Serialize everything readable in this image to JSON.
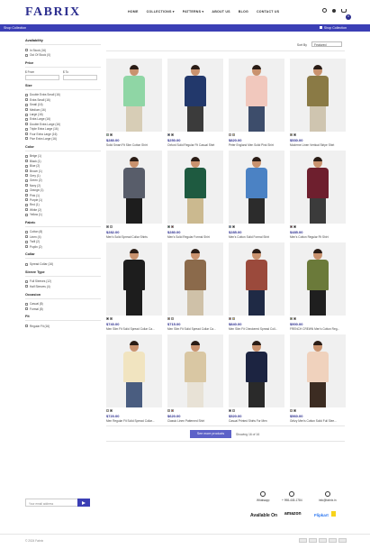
{
  "header": {
    "logo": "FABRIX",
    "nav": [
      "HOME",
      "COLLECTIONS ▾",
      "PATTERNS ▾",
      "ABOUT US",
      "BLOG",
      "CONTACT US"
    ],
    "cart_count": "0"
  },
  "banner": {
    "title": "Shop Collection",
    "breadcrumb": "Shop Collection"
  },
  "filters": {
    "availability": {
      "title": "Availability",
      "options": [
        "In Stock (16)",
        "Out Of Stock (0)"
      ]
    },
    "price": {
      "title": "Price",
      "from": "$ From",
      "to": "$ To"
    },
    "size": {
      "title": "Size",
      "options": [
        "Double Extra Small (16)",
        "Extra Small (16)",
        "Small (16)",
        "Medium (16)",
        "Large (16)",
        "Extra Large (16)",
        "Double Extra Large (16)",
        "Triple Extra Large (16)",
        "Four Extra Large (16)",
        "Five Extra Large (16)"
      ]
    },
    "color": {
      "title": "Color",
      "options": [
        "Beige (1)",
        "Black (1)",
        "Blue (2)",
        "Brown (1)",
        "Grey (1)",
        "Green (2)",
        "Navy (2)",
        "Orange (1)",
        "Pink (1)",
        "Purple (1)",
        "Red (1)",
        "White (2)",
        "Yellow (1)"
      ]
    },
    "fabric": {
      "title": "Fabric",
      "options": [
        "Cotton (8)",
        "Linen (4)",
        "Twill (2)",
        "Poplin (2)"
      ]
    },
    "collar": {
      "title": "Collar",
      "options": [
        "Spread Collar (16)"
      ]
    },
    "sleeve": {
      "title": "Sleeve Type",
      "options": [
        "Full Sleeves (12)",
        "Half Sleeves (4)"
      ]
    },
    "occasion": {
      "title": "Occasion",
      "options": [
        "Casual (8)",
        "Formal (8)"
      ]
    },
    "fit": {
      "title": "Fit",
      "options": [
        "Regular Fit (16)"
      ]
    }
  },
  "sort": {
    "label": "Sort By",
    "value": "Featured"
  },
  "products": [
    {
      "name": "Solid Smart Fit Slim Cotton Shirt",
      "price": "$280.00",
      "shirt": "#8fd6a5",
      "pants": "#d7cdb6",
      "swatches": [
        "#8fd6a5",
        "#3d3d3d"
      ]
    },
    {
      "name": "Oxford Solid Regular Fit Casual Shirt",
      "price": "$250.00",
      "shirt": "#22386b",
      "pants": "#3b3b3b",
      "swatches": [
        "#22386b",
        "#3d3d3d"
      ]
    },
    {
      "name": "Peter England Men Solid Pink Shirt",
      "price": "$820.00",
      "shirt": "#f1c8bd",
      "pants": "#3d4d6b",
      "swatches": [
        "#f1c8bd",
        "#d9c58a"
      ]
    },
    {
      "name": "Moderne Linen Vertical Stripe Shirt",
      "price": "$530.00",
      "shirt": "#8a7a45",
      "pants": "#cfc5b0",
      "swatches": [
        "#8a7a45",
        "#3d3d3d"
      ]
    },
    {
      "name": "Men's Solid Spread Collar Shirts",
      "price": "$282.00",
      "shirt": "#585d6a",
      "pants": "#1d1d1d",
      "swatches": [
        "#585d6a",
        "#e0e0e0"
      ]
    },
    {
      "name": "Men's Solid Regular Formal Shirt",
      "price": "$280.00",
      "shirt": "#1e5a40",
      "pants": "#cbb98f",
      "swatches": [
        "#1e5a40",
        "#7a2a2a"
      ]
    },
    {
      "name": "Men's Cotton Solid Formal Shirt",
      "price": "$285.00",
      "shirt": "#4b82c4",
      "pants": "#2c2c2c",
      "swatches": [
        "#4b82c4",
        "#2c2c2c"
      ]
    },
    {
      "name": "Men's Cotton Regular Fit Shirt",
      "price": "$485.00",
      "shirt": "#6e1f2e",
      "pants": "#3b3b3b",
      "swatches": [
        "#6e1f2e",
        "#1f1f1f"
      ]
    },
    {
      "name": "Men Slim Fit Solid Spread Collar Ca...",
      "price": "$740.00",
      "shirt": "#1d1d1d",
      "pants": "#1d1d1d",
      "swatches": [
        "#1d1d1d",
        "#5a5a5a"
      ]
    },
    {
      "name": "Men Slim Fit Solid Spread Collar Ca...",
      "price": "$715.00",
      "shirt": "#8b6a4b",
      "pants": "#cfc1a8",
      "swatches": [
        "#8b6a4b",
        "#d4cbb5"
      ]
    },
    {
      "name": "Men Slim Fit Checkered Spread Coll...",
      "price": "$840.00",
      "shirt": "#9b4a3c",
      "pants": "#1f2a45",
      "swatches": [
        "#9b4a3c",
        "#e6c95a"
      ]
    },
    {
      "name": "FRENCH CREWN Men's Cotton Reg...",
      "price": "$900.00",
      "shirt": "#6b7a3a",
      "pants": "#1f1f1f",
      "swatches": [
        "#6b7a3a",
        "#4b3a2a"
      ]
    },
    {
      "name": "Men Regular Fit Solid Spread Collar...",
      "price": "$720.00",
      "shirt": "#f1e4c0",
      "pants": "#4a5d80",
      "swatches": [
        "#f1e4c0",
        "#3d3d3d"
      ]
    },
    {
      "name": "Classic Linen Patterned Shirt",
      "price": "$620.00",
      "shirt": "#d9c7a3",
      "pants": "#e8e2d6",
      "swatches": [
        "#d9c7a3",
        "#c24a3c"
      ]
    },
    {
      "name": "Casual Printed Shirts For Men",
      "price": "$520.00",
      "shirt": "#1c2441",
      "pants": "#2a2a2a",
      "swatches": [
        "#1c2441",
        "#d1d1d1"
      ]
    },
    {
      "name": "Gritzy Men's Cotton Solid Full Slee...",
      "price": "$560.00",
      "shirt": "#f0d2bd",
      "pants": "#3c2c22",
      "swatches": [
        "#f0d2bd",
        "#3d3d3d"
      ]
    }
  ],
  "pagination": {
    "button": "See more products",
    "status": "Showing 16 of 16"
  },
  "footer": {
    "email_placeholder": "Your email address",
    "contacts": [
      {
        "label": "Whatsapp",
        "icon": "whatsapp-icon"
      },
      {
        "label": "+ 998-445-1784",
        "icon": "phone-icon"
      },
      {
        "label": "info@fabrix.in",
        "icon": "mail-icon"
      }
    ],
    "available_on": "Available On",
    "amazon": "amazon",
    "flipkart": "Flipkart",
    "copyright": "© 2024 Fabrix"
  },
  "colors": {
    "accent": "#3b3fb5",
    "brand": "#2c2e8f"
  }
}
